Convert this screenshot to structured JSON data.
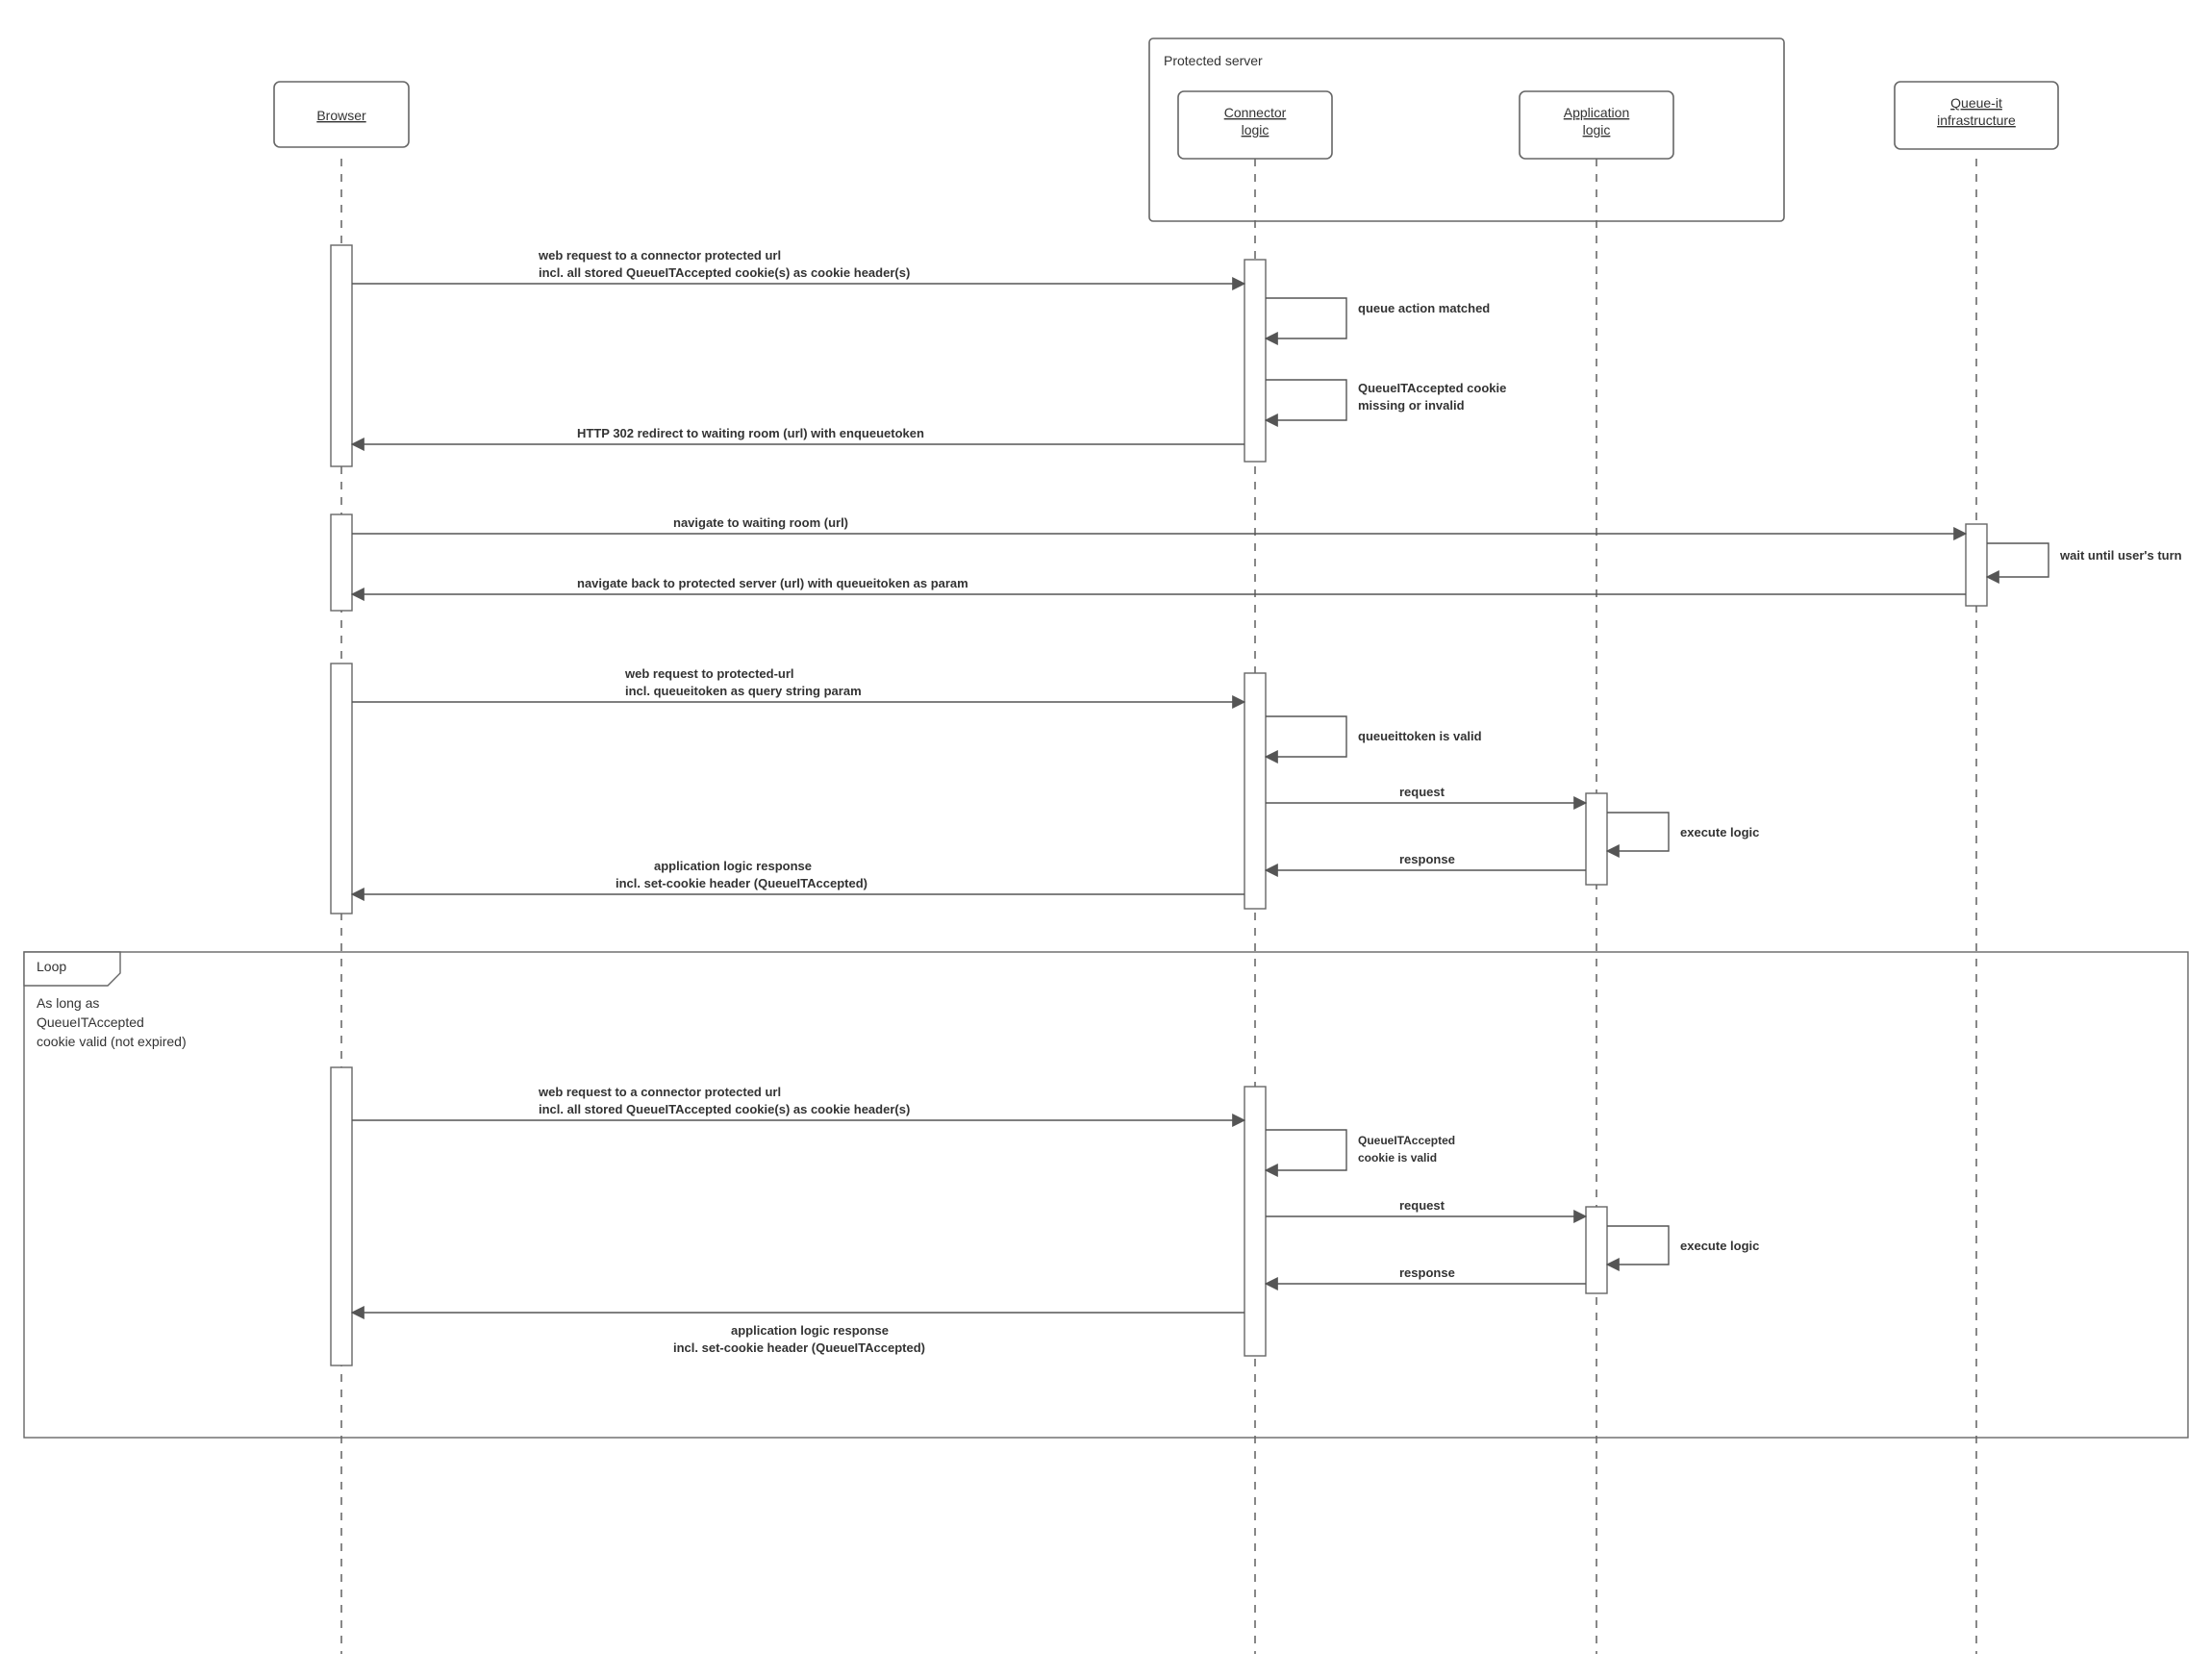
{
  "participants": {
    "browser": "Browser",
    "connector": "Connector\nlogic",
    "application": "Application\nlogic",
    "queueit": "Queue-it\ninfrastructure",
    "group_title": "Protected server"
  },
  "messages": {
    "m1a": "web request to a connector protected url",
    "m1b": "incl. all stored QueueITAccepted cookie(s) as cookie header(s)",
    "m2": "queue action matched",
    "m3a": "QueueITAccepted cookie",
    "m3b": "missing or invalid",
    "m4": "HTTP 302 redirect to waiting room (url) with enqueuetoken",
    "m5": "navigate to waiting room (url)",
    "m6": "wait until user's turn",
    "m7": "navigate back to protected server (url) with queueitoken as param",
    "m8a": "web request to protected-url",
    "m8b": "incl. queueitoken as query string param",
    "m9": "queueittoken is valid",
    "m10": "request",
    "m11": "execute logic",
    "m12": "response",
    "m13a": "application logic response",
    "m13b": "incl. set-cookie header (QueueITAccepted)",
    "loop_title": "Loop",
    "loop_cond1": "As long as",
    "loop_cond2": "QueueITAccepted",
    "loop_cond3": "cookie valid (not expired)",
    "l1a": "web request to a connector protected url",
    "l1b": "incl. all stored QueueITAccepted cookie(s) as cookie header(s)",
    "l2a": "QueueITAccepted",
    "l2b": "cookie is valid",
    "l3": "request",
    "l4": "execute logic",
    "l5": "response",
    "l6a": "application logic response",
    "l6b": "incl. set-cookie header (QueueITAccepted)"
  }
}
